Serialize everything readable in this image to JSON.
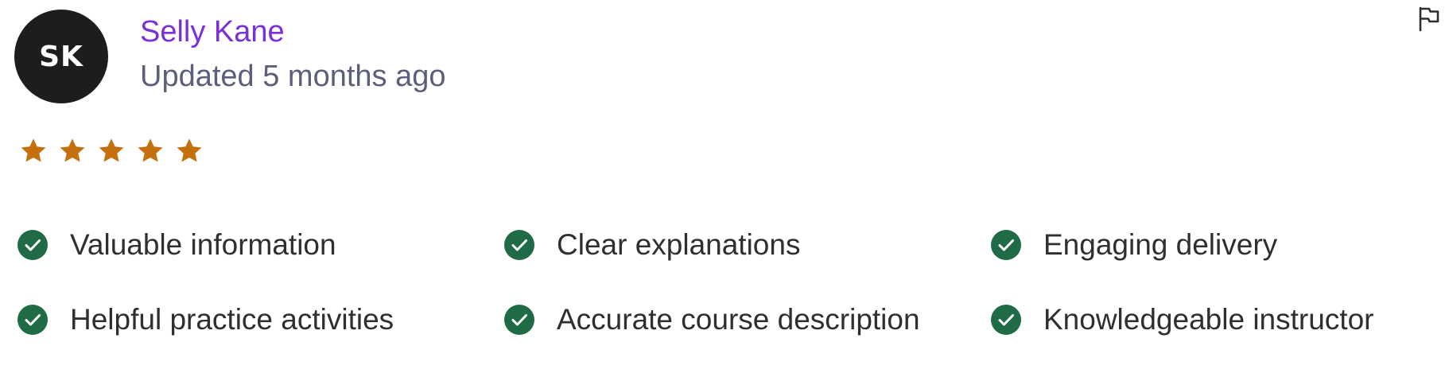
{
  "reviewer": {
    "initials": "SK",
    "name": "Selly Kane",
    "updated": "Updated 5 months ago"
  },
  "rating": {
    "value": 5,
    "max": 5,
    "color": "#c4710d"
  },
  "icons": {
    "report": "flag-icon",
    "star": "star-icon",
    "check": "check-circle-icon"
  },
  "colors": {
    "name_link": "#7b2fd8",
    "avatar_bg": "#1c1d1f",
    "check": "#1f6b45",
    "text": "#2d2f31",
    "muted": "#5c5f7a"
  },
  "feedback_tags": [
    "Valuable information",
    "Clear explanations",
    "Engaging delivery",
    "Helpful practice activities",
    "Accurate course description",
    "Knowledgeable instructor"
  ]
}
